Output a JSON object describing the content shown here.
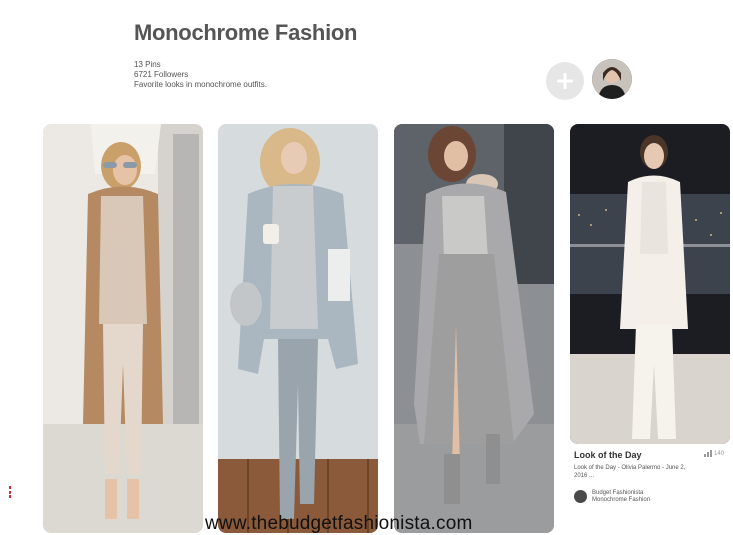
{
  "board": {
    "title": "Monochrome Fashion",
    "pins_count": "13 Pins",
    "followers": "6721 Followers",
    "description": "Favorite looks in monochrome outfits."
  },
  "actions": {
    "add_icon": "plus-icon",
    "avatar_icon": "user-avatar"
  },
  "pins": [
    {
      "palette": [
        "#e8e4df",
        "#b58a62",
        "#d9c8b8"
      ]
    },
    {
      "palette": [
        "#cdd3d4",
        "#aab7c0",
        "#b5a99a"
      ]
    },
    {
      "palette": [
        "#c9c9c7",
        "#a9a9ab",
        "#8f8f90"
      ]
    },
    {
      "palette": [
        "#1b1d22",
        "#f4efe8",
        "#a9adb2"
      ]
    }
  ],
  "pin_card": {
    "title": "Look of the Day",
    "count": "140",
    "description": "Look of the Day - Olivia Palermo - June 2, 2016 ...",
    "pinner_name": "Budget Fashionista",
    "pinner_board": "Monochrome Fashion"
  },
  "watermark": "www.thebudgetfashionista.com",
  "colors": {
    "title": "#555555",
    "button_bg": "#e6e6e6",
    "watermark": "#111111"
  }
}
